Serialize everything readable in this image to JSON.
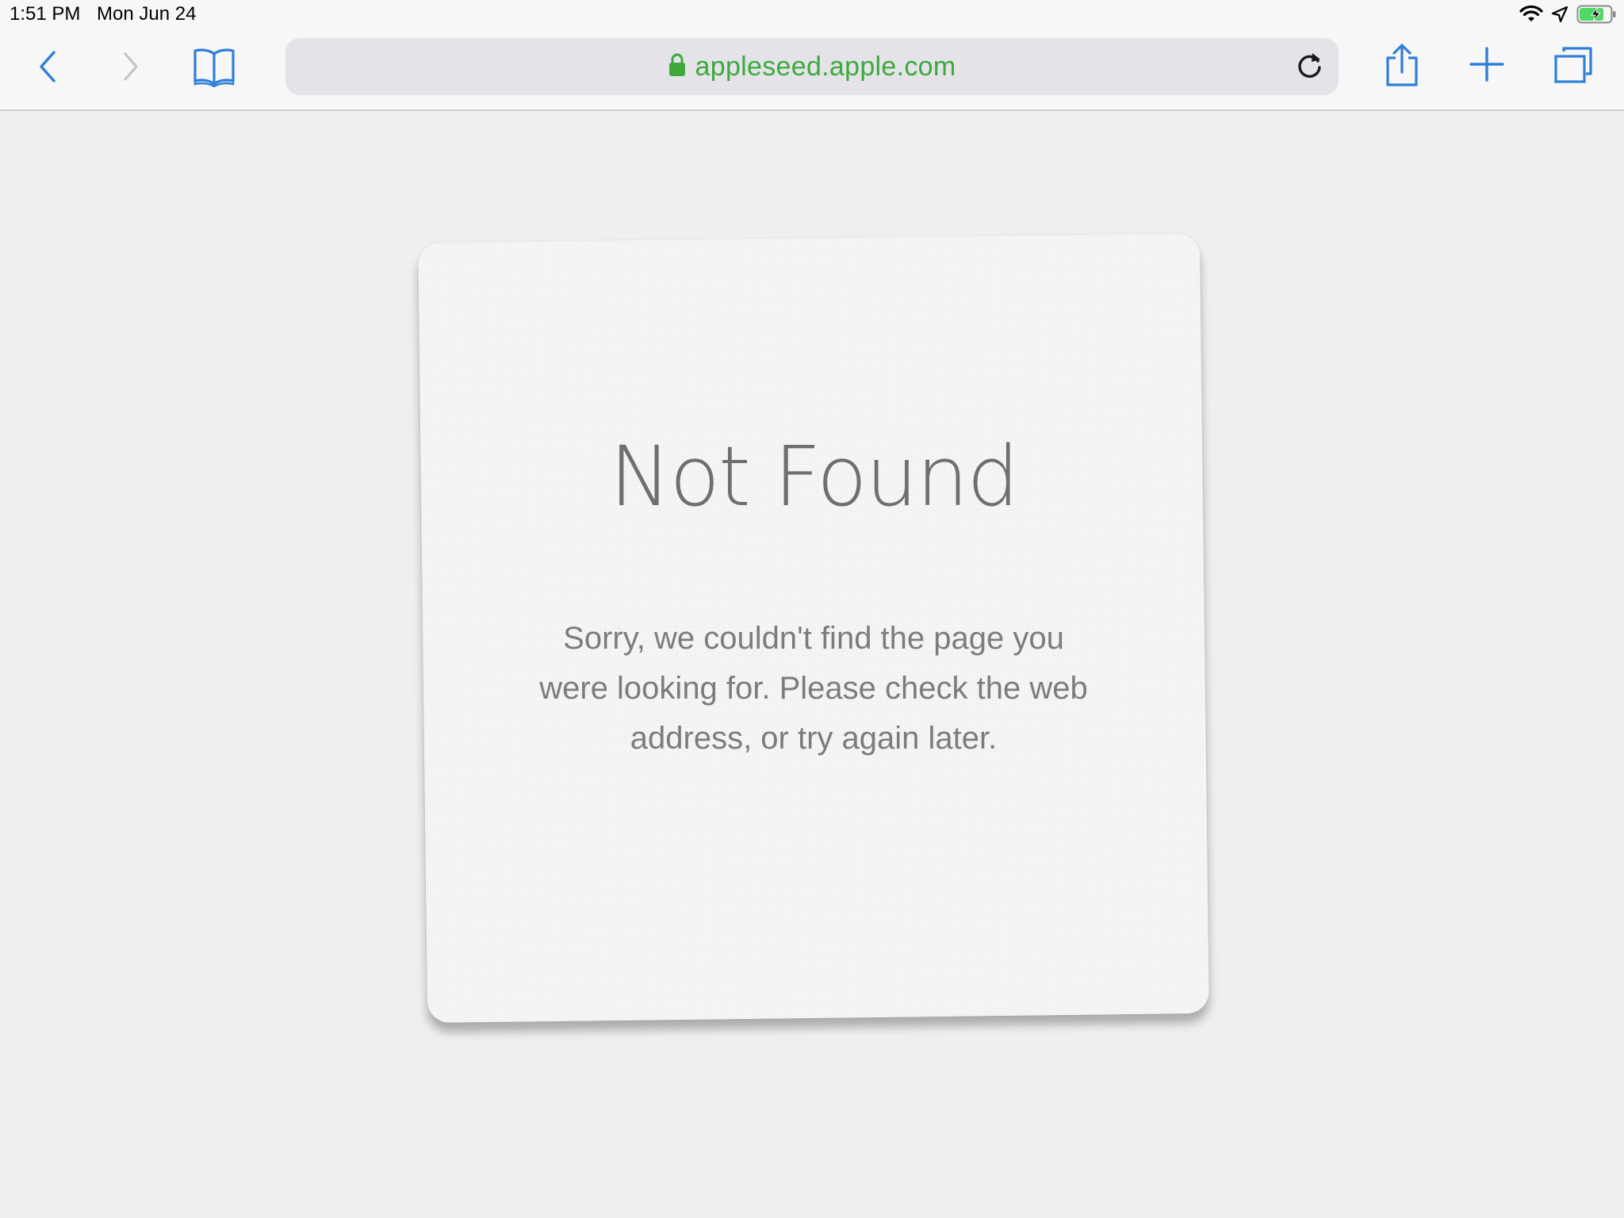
{
  "status_bar": {
    "time": "1:51 PM",
    "date": "Mon Jun 24",
    "icons": [
      "wifi-icon",
      "location-arrow-icon",
      "battery-charging-icon"
    ],
    "battery_color": "#4cd964"
  },
  "toolbar": {
    "back_icon": "chevron-left-icon",
    "forward_icon": "chevron-right-icon",
    "bookmarks_icon": "open-book-icon",
    "share_icon": "share-icon",
    "new_tab_icon": "plus-icon",
    "tabs_icon": "tabs-icon",
    "accent_color": "#2f7fd8"
  },
  "address_bar": {
    "url": "appleseed.apple.com",
    "lock_icon": "lock-icon",
    "reload_icon": "reload-icon",
    "secure_color": "#3ea83d"
  },
  "page": {
    "title": "Not Found",
    "message": "Sorry, we couldn't find the page you were looking for. Please check the web address, or try again later."
  }
}
